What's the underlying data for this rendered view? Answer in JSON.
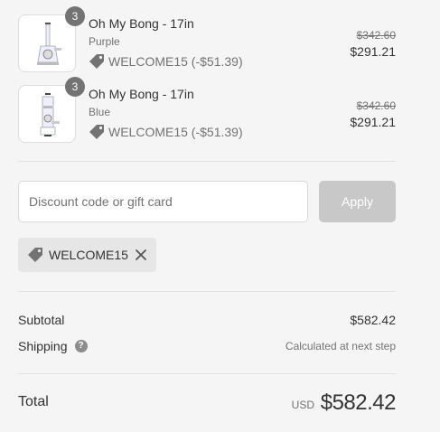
{
  "items": [
    {
      "name": "Oh My Bong - 17in",
      "variant": "Purple",
      "quantity": "3",
      "discount": "WELCOME15 (-$51.39)",
      "original_price": "$342.60",
      "price": "$291.21"
    },
    {
      "name": "Oh My Bong - 17in",
      "variant": "Blue",
      "quantity": "3",
      "discount": "WELCOME15 (-$51.39)",
      "original_price": "$342.60",
      "price": "$291.21"
    }
  ],
  "discount_form": {
    "placeholder": "Discount code or gift card",
    "value": "",
    "apply_label": "Apply"
  },
  "applied_code": "WELCOME15",
  "summary": {
    "subtotal_label": "Subtotal",
    "subtotal_value": "$582.42",
    "shipping_label": "Shipping",
    "shipping_value": "Calculated at next step",
    "total_label": "Total",
    "currency": "USD",
    "total_value": "$582.42"
  },
  "icons": {
    "tag": "tag-icon",
    "remove": "close-icon",
    "help": "question-circle-icon"
  },
  "colors": {
    "background": "#f5f5f5",
    "badge": "#737373",
    "apply_button": "#c8c8c8",
    "chip": "#e6e6e6"
  }
}
